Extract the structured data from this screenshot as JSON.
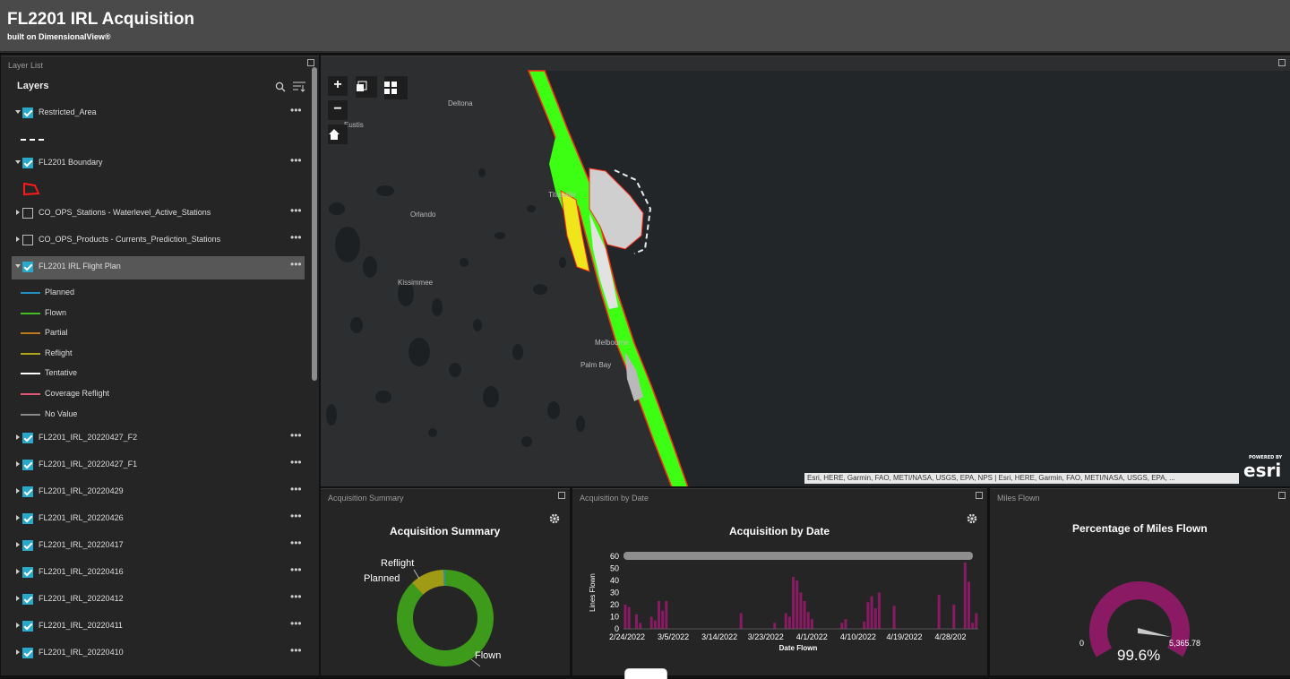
{
  "header": {
    "title": "FL2201 IRL Acquisition",
    "subtitle": "built on DimensionalView®"
  },
  "layer_list": {
    "panel_title": "Layer List",
    "heading": "Layers",
    "rows": [
      {
        "label": "Restricted_Area",
        "checked": true,
        "expanded": true
      },
      {
        "label": "FL2201 Boundary",
        "checked": true,
        "expanded": true
      },
      {
        "label": "CO_OPS_Stations - Waterlevel_Active_Stations",
        "checked": false,
        "expanded": false
      },
      {
        "label": "CO_OPS_Products - Currents_Prediction_Stations",
        "checked": false,
        "expanded": false
      },
      {
        "label": "FL2201 IRL Flight Plan",
        "checked": true,
        "expanded": true,
        "selected": true
      }
    ],
    "legend": [
      {
        "label": "Planned",
        "color": "#1f8fc4"
      },
      {
        "label": "Flown",
        "color": "#3fbf20"
      },
      {
        "label": "Partial",
        "color": "#c07a1c"
      },
      {
        "label": "Reflight",
        "color": "#b0a418"
      },
      {
        "label": "Tentative",
        "color": "#ffffff"
      },
      {
        "label": "Coverage Reflight",
        "color": "#e0557a"
      },
      {
        "label": "No Value",
        "color": "#8a8a8a"
      }
    ],
    "flights": [
      "FL2201_IRL_20220427_F2",
      "FL2201_IRL_20220427_F1",
      "FL2201_IRL_20220429",
      "FL2201_IRL_20220426",
      "FL2201_IRL_20220417",
      "FL2201_IRL_20220416",
      "FL2201_IRL_20220412",
      "FL2201_IRL_20220411",
      "FL2201_IRL_20220410"
    ]
  },
  "map": {
    "places": [
      "Deltona",
      "Eustis",
      "Titusville",
      "Orlando",
      "Kissimmee",
      "Melbourne",
      "Palm Bay"
    ],
    "attribution": "Esri, HERE, Garmin, FAO, METI/NASA, USGS, EPA, NPS | Esri, HERE, Garmin, FAO, METI/NASA, USGS, EPA, ...",
    "logo_small": "POWERED BY",
    "logo": "esri",
    "zoom_in": "+",
    "zoom_out": "−"
  },
  "summary": {
    "panel_title": "Acquisition Summary",
    "chart_title": "Acquisition Summary",
    "labels": {
      "reflight": "Reflight",
      "planned": "Planned",
      "flown": "Flown"
    }
  },
  "by_date": {
    "panel_title": "Acquisition by Date",
    "chart_title": "Acquisition by Date",
    "ylabel": "Lines Flown",
    "xlabel": "Date Flown",
    "y_ticks": [
      "60",
      "50",
      "40",
      "30",
      "20",
      "10",
      "0"
    ],
    "x_ticks": [
      "2/24/2022",
      "3/5/2022",
      "3/14/2022",
      "3/23/2022",
      "4/1/2022",
      "4/10/2022",
      "4/19/2022",
      "4/28/202"
    ]
  },
  "miles": {
    "panel_title": "Miles Flown",
    "chart_title": "Percentage of Miles Flown",
    "min": "0",
    "max": "5,365.78",
    "value": "99.6%"
  },
  "chart_data": [
    {
      "type": "pie",
      "title": "Acquisition Summary",
      "categories": [
        "Flown",
        "Reflight",
        "Planned"
      ],
      "values": [
        88,
        11.5,
        0.5
      ],
      "colors": [
        "#3e9a1a",
        "#a19a15",
        "#1f8fc4"
      ]
    },
    {
      "type": "bar",
      "title": "Acquisition by Date",
      "xlabel": "Date Flown",
      "ylabel": "Lines Flown",
      "ylim": [
        0,
        60
      ],
      "color": "#8a1a64",
      "x_start": "2/24/2022",
      "values": [
        20,
        18,
        0,
        12,
        5,
        0,
        0,
        10,
        7,
        23,
        15,
        23,
        0,
        0,
        0,
        0,
        0,
        0,
        0,
        0,
        0,
        0,
        0,
        0,
        0,
        0,
        0,
        0,
        0,
        0,
        0,
        13,
        0,
        0,
        0,
        0,
        0,
        0,
        0,
        0,
        5,
        0,
        0,
        13,
        10,
        43,
        40,
        30,
        23,
        14,
        8,
        0,
        0,
        0,
        0,
        0,
        0,
        0,
        5,
        8,
        0,
        0,
        0,
        0,
        6,
        22,
        27,
        17,
        30,
        0,
        0,
        0,
        19,
        0,
        0,
        0,
        0,
        0,
        0,
        0,
        0,
        0,
        0,
        0,
        28,
        0,
        0,
        0,
        20,
        0,
        0,
        55,
        39,
        5,
        13
      ]
    },
    {
      "type": "gauge",
      "title": "Percentage of Miles Flown",
      "min": 0,
      "max": 5365.78,
      "value_pct": 99.6,
      "color": "#8a1a64"
    }
  ]
}
